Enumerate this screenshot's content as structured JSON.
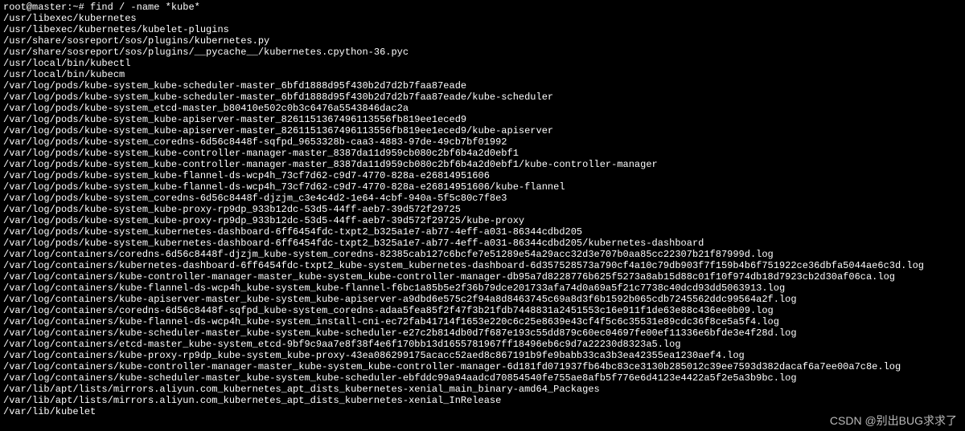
{
  "prompt": "root@master:~# ",
  "command": "find / -name *kube*",
  "lines": [
    "/usr/libexec/kubernetes",
    "/usr/libexec/kubernetes/kubelet-plugins",
    "/usr/share/sosreport/sos/plugins/kubernetes.py",
    "/usr/share/sosreport/sos/plugins/__pycache__/kubernetes.cpython-36.pyc",
    "/usr/local/bin/kubectl",
    "/usr/local/bin/kubecm",
    "/var/log/pods/kube-system_kube-scheduler-master_6bfd1888d95f430b2d7d2b7faa87eade",
    "/var/log/pods/kube-system_kube-scheduler-master_6bfd1888d95f430b2d7d2b7faa87eade/kube-scheduler",
    "/var/log/pods/kube-system_etcd-master_b80410e502c0b3c6476a5543846dac2a",
    "/var/log/pods/kube-system_kube-apiserver-master_8261151367496113556fb819ee1eced9",
    "/var/log/pods/kube-system_kube-apiserver-master_8261151367496113556fb819ee1eced9/kube-apiserver",
    "/var/log/pods/kube-system_coredns-6d56c8448f-sqfpd_9653328b-caa3-4883-97de-49cb7bf01992",
    "/var/log/pods/kube-system_kube-controller-manager-master_8387da11d959cb080c2bf6b4a2d0ebf1",
    "/var/log/pods/kube-system_kube-controller-manager-master_8387da11d959cb080c2bf6b4a2d0ebf1/kube-controller-manager",
    "/var/log/pods/kube-system_kube-flannel-ds-wcp4h_73cf7d62-c9d7-4770-828a-e26814951606",
    "/var/log/pods/kube-system_kube-flannel-ds-wcp4h_73cf7d62-c9d7-4770-828a-e26814951606/kube-flannel",
    "/var/log/pods/kube-system_coredns-6d56c8448f-djzjm_c3e4c4d2-1e64-4cbf-940a-5f5c80c7f8e3",
    "/var/log/pods/kube-system_kube-proxy-rp9dp_933b12dc-53d5-44ff-aeb7-39d572f29725",
    "/var/log/pods/kube-system_kube-proxy-rp9dp_933b12dc-53d5-44ff-aeb7-39d572f29725/kube-proxy",
    "/var/log/pods/kube-system_kubernetes-dashboard-6ff6454fdc-txpt2_b325a1e7-ab77-4eff-a031-86344cdbd205",
    "/var/log/pods/kube-system_kubernetes-dashboard-6ff6454fdc-txpt2_b325a1e7-ab77-4eff-a031-86344cdbd205/kubernetes-dashboard",
    "/var/log/containers/coredns-6d56c8448f-djzjm_kube-system_coredns-82385cab127c6bcfe7e51289e54a29acc32d3e707b0aa85cc22307b21f87999d.log",
    "/var/log/containers/kubernetes-dashboard-6ff6454fdc-txpt2_kube-system_kubernetes-dashboard-6d357528573a790cf4a10c79db903f7f159b4b6f751922ce36dbfa5044ae6c3d.log",
    "/var/log/containers/kube-controller-manager-master_kube-system_kube-controller-manager-db95a7d8228776b625f5273a8ab15d88c01f10f974db18d7923cb2d30af06ca.log",
    "/var/log/containers/kube-flannel-ds-wcp4h_kube-system_kube-flannel-f6bc1a85b5e2f36b79dce201733afa74d0a69a5f21c7738c40dcd93dd5063913.log",
    "/var/log/containers/kube-apiserver-master_kube-system_kube-apiserver-a9dbd6e575c2f94a8d8463745c69a8d3f6b1592b065cdb7245562ddc99564a2f.log",
    "/var/log/containers/coredns-6d56c8448f-sqfpd_kube-system_coredns-adaa5fea85f2f47f3b21fdb7448831a2451553c16e911f1de63e88c436ee0b09.log",
    "/var/log/containers/kube-flannel-ds-wcp4h_kube-system_install-cni-ec72fab41714f1653e220c6c25e8639e43cf4f5c6c35531e89cdc36f8ce5a5f4.log",
    "/var/log/containers/kube-scheduler-master_kube-system_kube-scheduler-e27c2b814db0d7f687e193c55dd879c60ec04697fe00ef11336e6bfde3e4f28d.log",
    "/var/log/containers/etcd-master_kube-system_etcd-9bf9c9aa7e8f38f4e6f170bb13d1655781967ff18496eb6c9d7a22230d8323a5.log",
    "/var/log/containers/kube-proxy-rp9dp_kube-system_kube-proxy-43ea086299175acacc52aed8c867191b9fe9babb33ca3b3ea42355ea1230aef4.log",
    "/var/log/containers/kube-controller-manager-master_kube-system_kube-controller-manager-6d181fd071937fb64bc83ce3130b285012c39ee7593d382dacaf6a7ee00a7c8e.log",
    "/var/log/containers/kube-scheduler-master_kube-system_kube-scheduler-ebfddc99a94aadcd70854540fe755ae8afb5f776e6d4123e4422a5f2e5a3b9bc.log",
    "/var/lib/apt/lists/mirrors.aliyun.com_kubernetes_apt_dists_kubernetes-xenial_main_binary-amd64_Packages",
    "/var/lib/apt/lists/mirrors.aliyun.com_kubernetes_apt_dists_kubernetes-xenial_InRelease",
    "/var/lib/kubelet"
  ],
  "watermark": "CSDN @别出BUG求求了"
}
